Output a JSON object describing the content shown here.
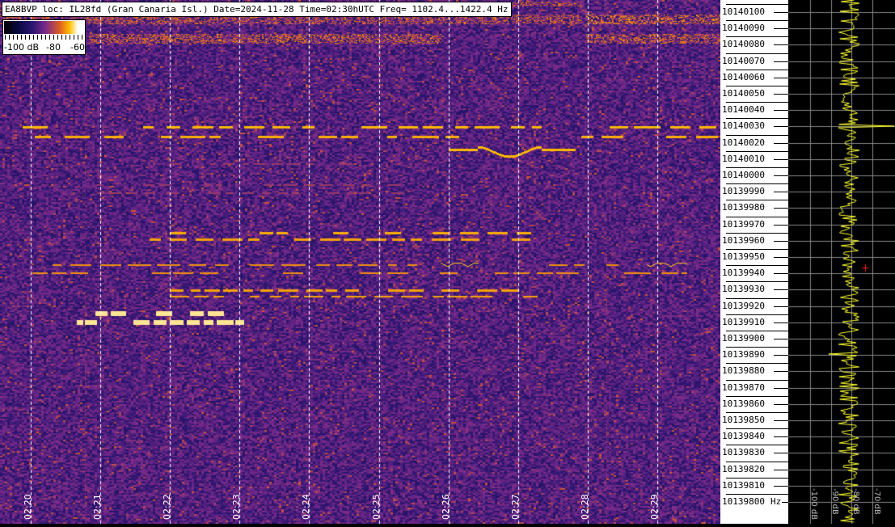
{
  "header": {
    "title": "EA8BVP loc: IL28fd (Gran Canaria Isl.) Date=2024-11-28 Time=02:30hUTC Freq= 1102.4...1422.4 Hz"
  },
  "colorbar": {
    "labels": [
      "-100 dB",
      "-80",
      "-60"
    ],
    "colormap": [
      "#000000",
      "#0a0a40",
      "#2a1570",
      "#7a2a8a",
      "#e06020",
      "#ffc000",
      "#ffffff"
    ]
  },
  "chart_data": {
    "type": "heatmap",
    "title": "EA8BVP loc: IL28fd (Gran Canaria Isl.) Date=2024-11-28 Time=02:30hUTC Freq= 1102.4...1422.4 Hz",
    "x_ticks": [
      "02:20",
      "02:21",
      "02:22",
      "02:23",
      "02:24",
      "02:25",
      "02:26",
      "02:27",
      "02:28",
      "02:29"
    ],
    "y_ticks": [
      "10140100",
      "10140090",
      "10140080",
      "10140070",
      "10140060",
      "10140050",
      "10140040",
      "10140030",
      "10140020",
      "10140010",
      "10140000",
      "10139990",
      "10139980",
      "10139970",
      "10139960",
      "10139950",
      "10139940",
      "10139930",
      "10139920",
      "10139910",
      "10139900",
      "10139890",
      "10139880",
      "10139870",
      "10139860",
      "10139850",
      "10139840",
      "10139830",
      "10139820",
      "10139810",
      "10139800"
    ],
    "y_unit": "Hz",
    "ylim": [
      10139800,
      10140100
    ],
    "color_range_db": [
      -100,
      -60
    ],
    "grid": true
  },
  "spectrum": {
    "labels": [
      "-100 dB",
      "-90 dB",
      "-80 dB",
      "-70 dB"
    ],
    "trace_color": "#ffff30",
    "marker_color": "#ff2020"
  }
}
